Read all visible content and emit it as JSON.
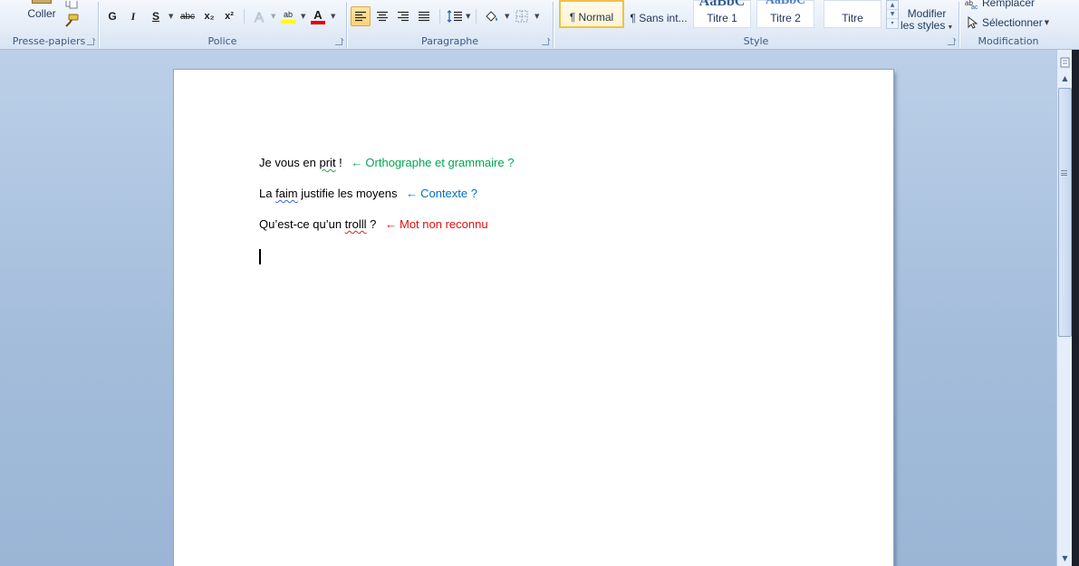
{
  "ribbon": {
    "clipboard": {
      "title": "Presse-papiers",
      "paste_label": "Coller"
    },
    "font": {
      "title": "Police",
      "bold": "G",
      "italic": "I",
      "underline": "S",
      "strikethrough": "abc",
      "subscript": "x₂",
      "superscript": "x²",
      "highlight_glyph": "ab",
      "font_color_glyph": "A",
      "highlight_color": "#ffff00",
      "font_color": "#e00000"
    },
    "paragraph": {
      "title": "Paragraphe"
    },
    "styles": {
      "title": "Style",
      "items": [
        {
          "label": "¶ Normal",
          "preview": "",
          "selected": true
        },
        {
          "label": "¶ Sans int...",
          "preview": ""
        },
        {
          "label": "Titre 1",
          "preview": "AaBbC"
        },
        {
          "label": "Titre 2",
          "preview": "AaBbC"
        },
        {
          "label": "Titre",
          "preview": ""
        }
      ],
      "change_styles_line1": "Modifier",
      "change_styles_line2": "les styles"
    },
    "editing": {
      "title": "Modification",
      "replace_label": "Remplacer",
      "select_label": "Sélectionner"
    }
  },
  "document": {
    "lines": [
      {
        "before": "Je vous en ",
        "flagged": "prit",
        "after": " !",
        "note": "Orthographe et grammaire ?",
        "note_color": "#00a651"
      },
      {
        "before": "La ",
        "flagged": "faim",
        "after": " justifie les moyens",
        "note": "Contexte ?",
        "note_color": "#0070c0"
      },
      {
        "before": "Qu’est-ce qu’un ",
        "flagged": "trolll",
        "after": " ?",
        "note": "Mot non reconnu",
        "note_color": "#e01010"
      }
    ],
    "arrow_glyph": "←"
  },
  "colors": {
    "page_bg": "#ffffff",
    "workspace_bg": "#a4bddb",
    "ribbon_bg": "#e4ecf7",
    "active_button": "#fbd277"
  }
}
